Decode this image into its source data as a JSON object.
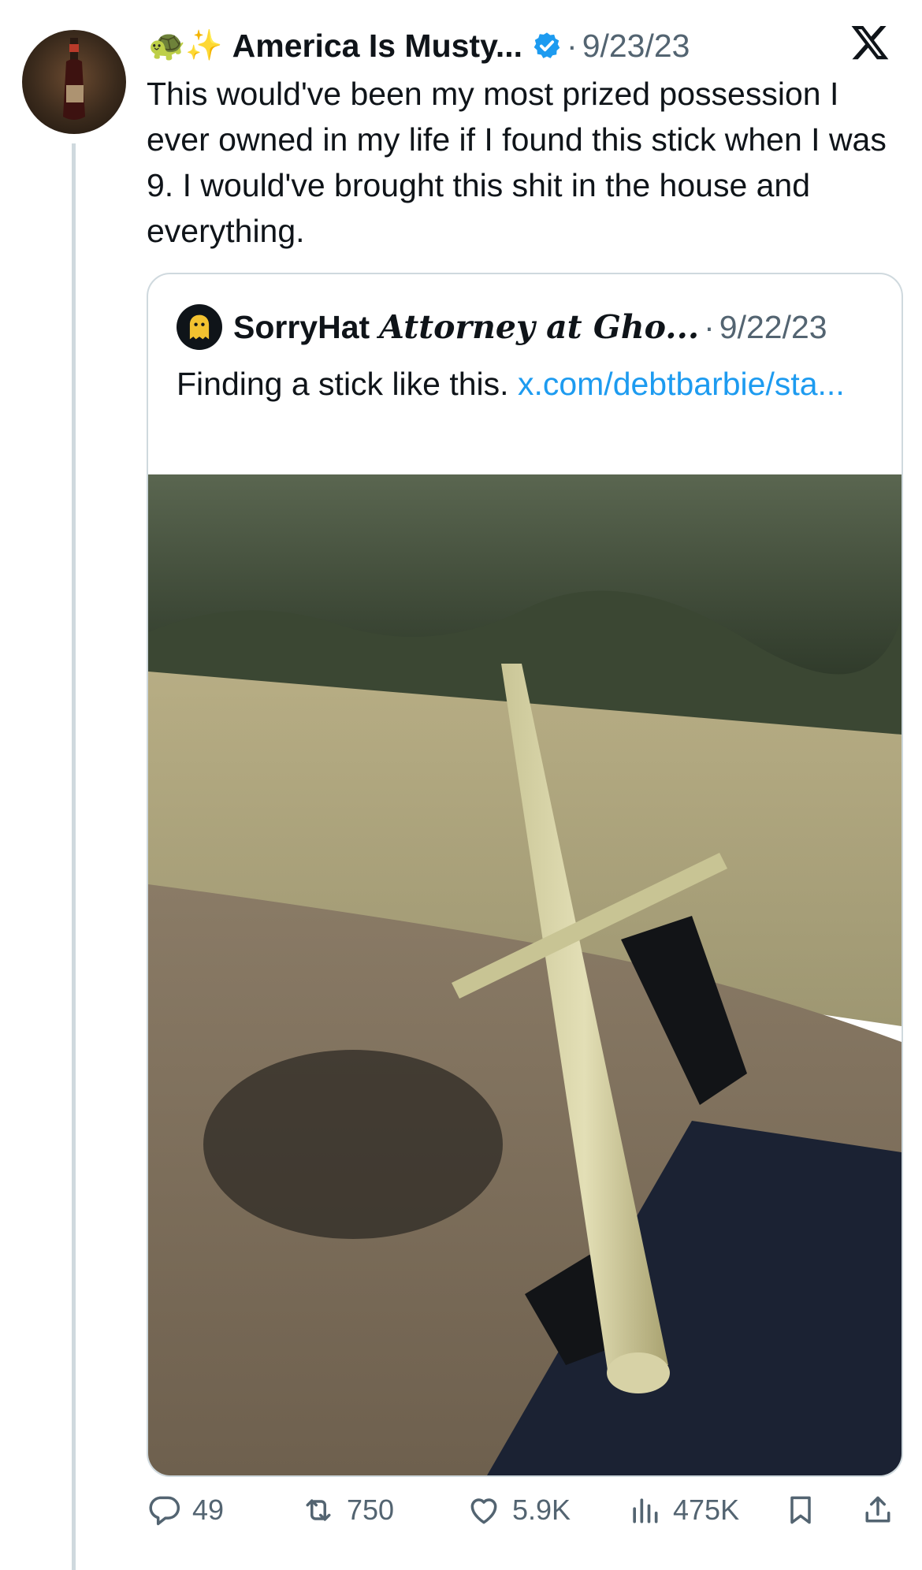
{
  "tweet": {
    "author_emoji": "🐢✨",
    "author_name": "America Is Musty...",
    "separator": "·",
    "date": "9/23/23",
    "text": "This would've been my most prized possession I ever owned in my life if I found this stick when I was 9. I would've brought this shit in the house and everything."
  },
  "quoted_tweet": {
    "author_name": "SorryHat",
    "author_title": "Attorney at Gho...",
    "separator": "·",
    "date": "9/22/23",
    "text": "Finding a stick like this. ",
    "link_text": "x.com/debtbarbie/sta..."
  },
  "actions": {
    "replies": "49",
    "reposts": "750",
    "likes": "5.9K",
    "views": "475K"
  },
  "colors": {
    "text": "#0f1419",
    "muted": "#536471",
    "link": "#1d9bf0",
    "verified": "#1d9bf0",
    "border": "#cfd9de"
  },
  "icons": [
    "x-logo-icon",
    "verified-badge-icon",
    "reply-icon",
    "repost-icon",
    "like-icon",
    "views-icon",
    "bookmark-icon",
    "share-icon"
  ]
}
